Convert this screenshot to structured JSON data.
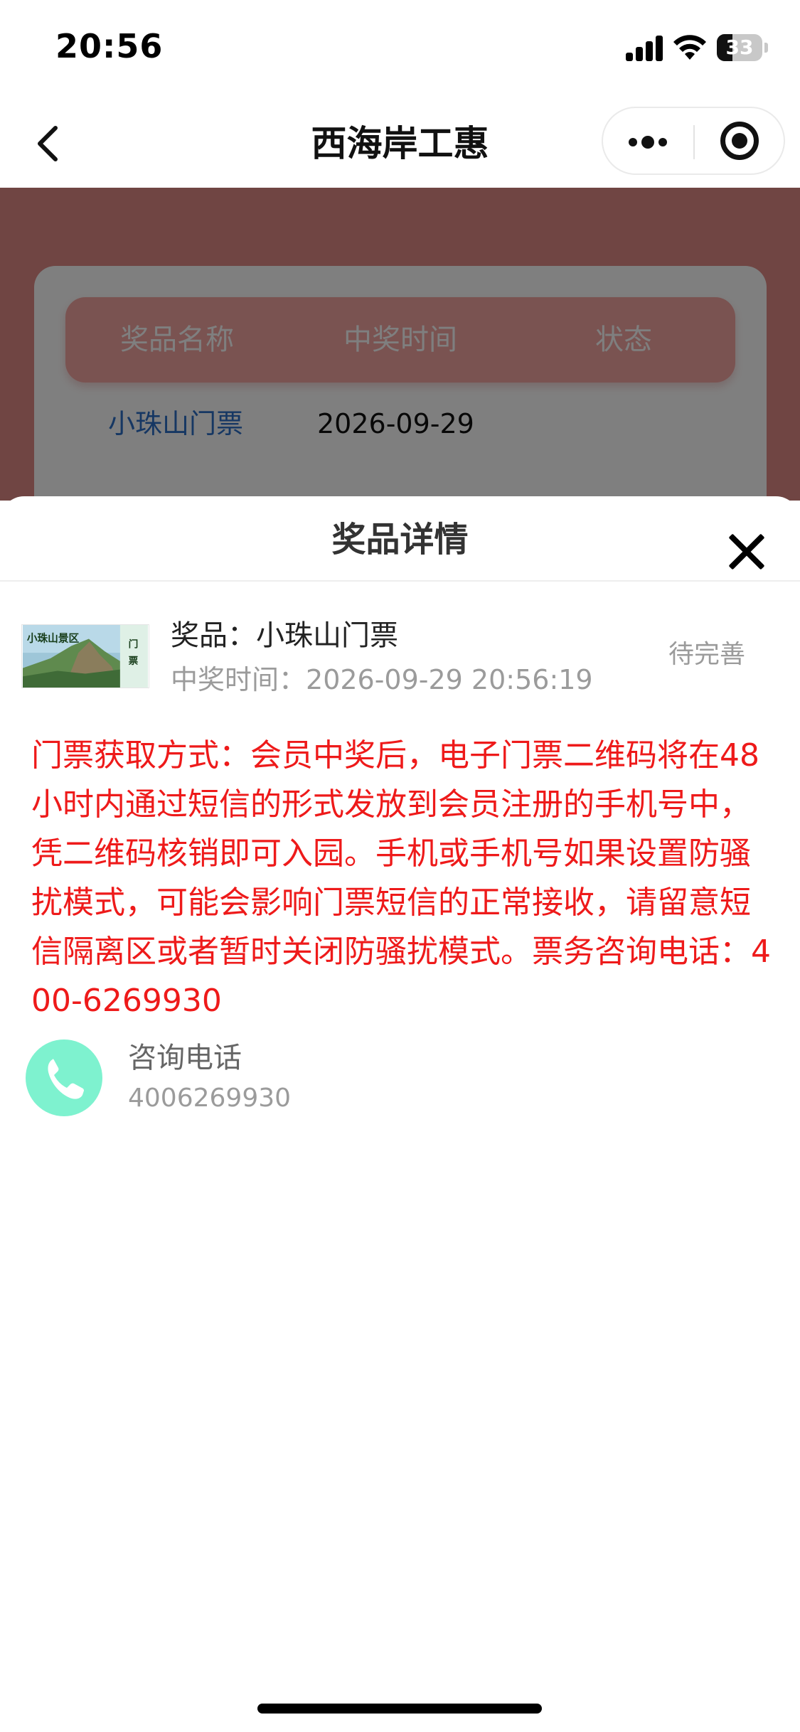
{
  "status_bar": {
    "time": "20:56",
    "battery": "33"
  },
  "nav": {
    "title": "西海岸工惠",
    "back_icon": "chevron-left-icon",
    "more_icon": "more-dots-icon",
    "close_icon": "target-circle-icon"
  },
  "background_page": {
    "table_headers": [
      "奖品名称",
      "中奖时间",
      "状态"
    ],
    "row": {
      "prize": "小珠山门票",
      "date": "2026-09-29"
    },
    "header_color": "#f5a6a3",
    "link_color": "#2c6fc7"
  },
  "sheet": {
    "title": "奖品详情",
    "close_icon": "close-x-icon",
    "prize": {
      "thumb_title": "小珠山景区",
      "thumb_badge_top": "门",
      "thumb_badge_bottom": "票",
      "name_label": "奖品：",
      "name": "小珠山门票",
      "time_label": "中奖时间：",
      "time": "2026-09-29 20:56:19",
      "status": "待完善"
    },
    "notice": "门票获取方式：会员中奖后，电子门票二维码将在48小时内通过短信的形式发放到会员注册的手机号中，凭二维码核销即可入园。手机或手机号如果设置防骚扰模式，可能会影响门票短信的正常接收，请留意短信隔离区或者暂时关闭防骚扰模式。票务咨询电话：400-6269930",
    "notice_color": "#ee1a1a",
    "contact": {
      "icon": "phone-icon",
      "label": "咨询电话",
      "number": "4006269930",
      "icon_color": "#7ef2cf"
    }
  }
}
